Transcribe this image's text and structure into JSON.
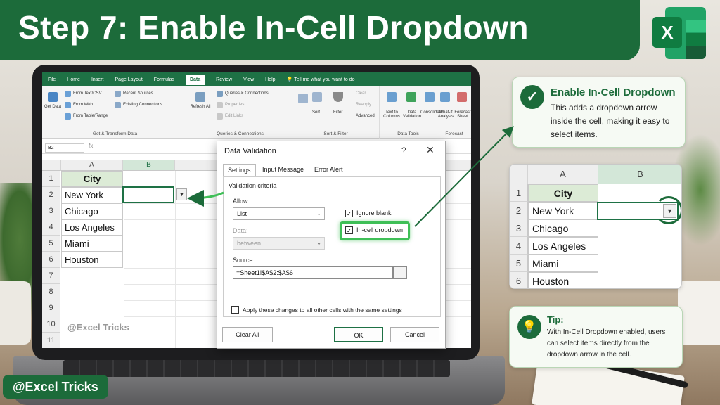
{
  "header": {
    "title": "Step 7: Enable In-Cell Dropdown"
  },
  "excel_logo": {
    "letter": "X"
  },
  "ribbon": {
    "tabs": [
      "File",
      "Home",
      "Insert",
      "Page Layout",
      "Formulas",
      "Data",
      "Review",
      "View",
      "Help"
    ],
    "active_tab": "Data",
    "tell_me": "Tell me what you want to do",
    "get_data": "Get Data",
    "from_text_csv": "From Text/CSV",
    "from_web": "From Web",
    "from_table_range": "From Table/Range",
    "recent_sources": "Recent Sources",
    "existing_connections": "Existing Connections",
    "group_get_transform": "Get & Transform Data",
    "refresh_all": "Refresh All",
    "queries_connections": "Queries & Connections",
    "properties": "Properties",
    "edit_links": "Edit Links",
    "group_queries": "Queries & Connections",
    "sort": "Sort",
    "filter": "Filter",
    "clear": "Clear",
    "reapply": "Reapply",
    "advanced": "Advanced",
    "group_sort_filter": "Sort & Filter",
    "text_to_columns": "Text to Columns",
    "data_validation": "Data Validation",
    "consolidate": "Consolidate",
    "group_data_tools": "Data Tools",
    "what_if": "What-If Analysis",
    "forecast_sheet": "Forecast Sheet",
    "group_forecast": "Forecast"
  },
  "formula_bar": {
    "name_box": "B2",
    "fx": "fx"
  },
  "sheet": {
    "columns": [
      "A",
      "B"
    ],
    "rows": [
      "1",
      "2",
      "3",
      "4",
      "5",
      "6",
      "7",
      "8",
      "9",
      "10",
      "11"
    ],
    "header": "City",
    "cities": [
      "New York",
      "Chicago",
      "Los Angeles",
      "Miami",
      "Houston"
    ]
  },
  "dialog": {
    "title": "Data Validation",
    "help": "?",
    "close": "✕",
    "tabs": [
      "Settings",
      "Input Message",
      "Error Alert"
    ],
    "section": "Validation criteria",
    "allow_label": "Allow:",
    "allow_value": "List",
    "data_label": "Data:",
    "data_value": "between",
    "ignore_blank": "Ignore blank",
    "in_cell_dropdown": "In-cell dropdown",
    "source_label": "Source:",
    "source_value": "=Sheet1!$A$2:$A$6",
    "apply_all": "Apply these changes to all other cells with the same settings",
    "clear_all": "Clear All",
    "ok": "OK",
    "cancel": "Cancel"
  },
  "callout": {
    "title": "Enable In-Cell Dropdown",
    "body": "This adds a dropdown arrow inside the cell, making it easy to select items."
  },
  "mini_sheet": {
    "columns": [
      "A",
      "B"
    ],
    "rows": [
      "1",
      "2",
      "3",
      "4",
      "5",
      "6"
    ],
    "header": "City",
    "cities": [
      "New York",
      "Chicago",
      "Los Angeles",
      "Miami",
      "Houston"
    ]
  },
  "tip": {
    "title": "Tip:",
    "body": "With In-Cell Dropdown enabled, users can select items directly from the dropdown arrow in the cell."
  },
  "watermark": "@Excel Tricks",
  "brand": "@Excel Tricks",
  "colors": {
    "brand_green": "#1c6b3a",
    "excel_green": "#1e7145",
    "highlight": "#3fbf57"
  }
}
